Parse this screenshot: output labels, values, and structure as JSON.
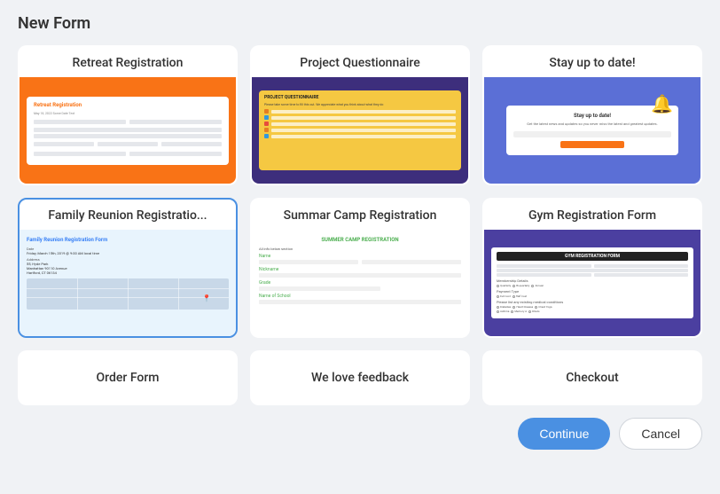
{
  "page": {
    "title": "New Form"
  },
  "cards": {
    "row1": [
      {
        "id": "retreat-registration",
        "label": "Retreat Registration",
        "selected": false
      },
      {
        "id": "project-questionnaire",
        "label": "Project Questionnaire",
        "selected": false
      },
      {
        "id": "stay-up-to-date",
        "label": "Stay up to date!",
        "selected": false
      }
    ],
    "row2": [
      {
        "id": "family-reunion-registration",
        "label": "Family Reunion Registratio...",
        "selected": true
      },
      {
        "id": "summer-camp-registration",
        "label": "Summar Camp Registration",
        "selected": false
      },
      {
        "id": "gym-registration-form",
        "label": "Gym Registration Form",
        "selected": false
      }
    ],
    "row3": [
      {
        "id": "order-form",
        "label": "Order Form"
      },
      {
        "id": "we-love-feedback",
        "label": "We love feedback"
      },
      {
        "id": "checkout",
        "label": "Checkout"
      }
    ]
  },
  "buttons": {
    "continue": "Continue",
    "cancel": "Cancel"
  },
  "previews": {
    "retreat": {
      "formTitle": "Retreat Registration",
      "subtitle": "May 18, 2022 Some Date Text"
    },
    "project": {
      "title": "PROJECT QUESTIONNAIRE"
    },
    "stay": {
      "title": "Stay up to date!",
      "text": "Get the latest news and updates so you never miss the latest and greatest updates."
    },
    "family": {
      "title": "Family Reunion Registration Form"
    },
    "summer": {
      "title": "SUMMER CAMP REGISTRATION"
    },
    "gym": {
      "title": "GYM REGISTRATION FORM"
    }
  }
}
